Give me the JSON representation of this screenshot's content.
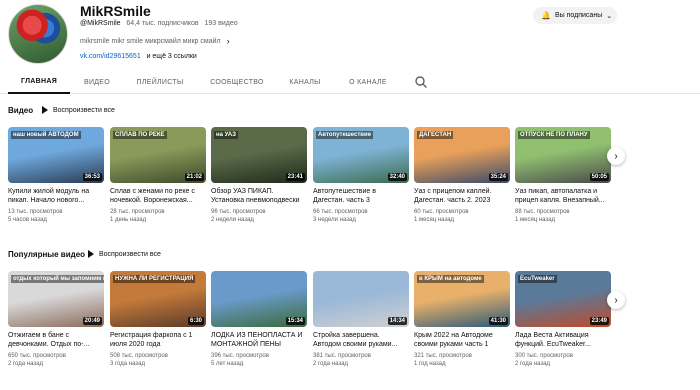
{
  "channel": {
    "name": "MikRSmile",
    "handle": "@MikRSmile",
    "subscribers": "64,4 тыс. подписчиков",
    "videos": "193 видео",
    "description": "mikrsmile mikr smile микрсмайл микр смайл",
    "link": "vk.com/id29615651",
    "more_links": "и ещё 3 ссылки",
    "subscribe_label": "Вы подписаны"
  },
  "tabs": [
    {
      "label": "ГЛАВНАЯ",
      "active": true
    },
    {
      "label": "ВИДЕО"
    },
    {
      "label": "ПЛЕЙЛИСТЫ"
    },
    {
      "label": "СООБЩЕСТВО"
    },
    {
      "label": "КАНАЛЫ"
    },
    {
      "label": "О КАНАЛЕ"
    }
  ],
  "sections": [
    {
      "title": "Видео",
      "play_all": "Воспроизвести все",
      "videos": [
        {
          "title": "Купили жилой модуль на пикап. Начало нового...",
          "views": "13 тыс. просмотров",
          "age": "5 часов назад",
          "duration": "36:53",
          "overlay": "наш новый АВТОДОМ",
          "colors": [
            "#6fa8dc",
            "#2a3b52"
          ]
        },
        {
          "title": "Сплав с женами по реке с ночевкой. Воронежская...",
          "views": "28 тыс. просмотров",
          "age": "1 день назад",
          "duration": "21:02",
          "overlay": "СПЛАВ ПО РЕКЕ",
          "colors": [
            "#8a9a5b",
            "#3d4a2a"
          ]
        },
        {
          "title": "Обзор УАЗ ПИКАП. Установка пневмоподвески",
          "views": "96 тыс. просмотров",
          "age": "2 недели назад",
          "duration": "23:41",
          "overlay": "на УАЗ",
          "colors": [
            "#5b6b4a",
            "#1f2a1a"
          ]
        },
        {
          "title": "Автопутешествие в Дагестан. часть 3",
          "views": "66 тыс. просмотров",
          "age": "3 недели назад",
          "duration": "32:40",
          "overlay": "Автопутешествие",
          "colors": [
            "#7fb3d5",
            "#3b6b4f"
          ]
        },
        {
          "title": "Уаз с прицепом каплей. Дагестан. часть 2. 2023",
          "views": "60 тыс. просмотров",
          "age": "1 месяц назад",
          "duration": "35:24",
          "overlay": "ДАГЕСТАН",
          "colors": [
            "#e8a05a",
            "#3a4a6a"
          ]
        },
        {
          "title": "Уаз пикап, автопалатка и прицеп капля. Внезапный...",
          "views": "88 тыс. просмотров",
          "age": "1 месяц назад",
          "duration": "50:05",
          "overlay": "ОТПУСК НЕ ПО ПЛАНУ",
          "colors": [
            "#8fbf6f",
            "#4a4a4a"
          ]
        }
      ]
    },
    {
      "title": "Популярные видео",
      "play_all": "Воспроизвести все",
      "videos": [
        {
          "title": "Отжигаем в бане с девчонками. Отдых по-...",
          "views": "650 тыс. просмотров",
          "age": "2 года назад",
          "duration": "20:49",
          "overlay": "отдых который мы запомним надолго",
          "colors": [
            "#d9d9d9",
            "#8a6a5a"
          ]
        },
        {
          "title": "Регистрация фаркопа с 1 июля 2020 года",
          "views": "508 тыс. просмотров",
          "age": "3 года назад",
          "duration": "6:30",
          "overlay": "НУЖНА ЛИ РЕГИСТРАЦИЯ",
          "colors": [
            "#c47a3a",
            "#5a3a2a"
          ]
        },
        {
          "title": "ЛОДКА ИЗ ПЕНОПЛАСТА И МОНТАЖНОЙ ПЕНЫ",
          "views": "396 тыс. просмотров",
          "age": "5 лет назад",
          "duration": "15:34",
          "overlay": "",
          "colors": [
            "#6a9ac9",
            "#3a6a3a"
          ]
        },
        {
          "title": "Стройка завершена. Автодом своими руками...",
          "views": "381 тыс. просмотров",
          "age": "2 года назад",
          "duration": "14:34",
          "overlay": "",
          "colors": [
            "#9ab8d8",
            "#d0d0d0"
          ]
        },
        {
          "title": "Крым 2022 на Автодоме своими руками часть 1",
          "views": "321 тыс. просмотров",
          "age": "1 год назад",
          "duration": "41:30",
          "overlay": "в КРЫМ на автодоме",
          "colors": [
            "#e8b06a",
            "#2a5a7a"
          ]
        },
        {
          "title": "Лада Веста Активация функций. EcuTweaker...",
          "views": "300 тыс. просмотров",
          "age": "2 года назад",
          "duration": "23:49",
          "overlay": "EcuTweaker",
          "colors": [
            "#5a7a9a",
            "#c04a2a"
          ]
        }
      ]
    }
  ]
}
